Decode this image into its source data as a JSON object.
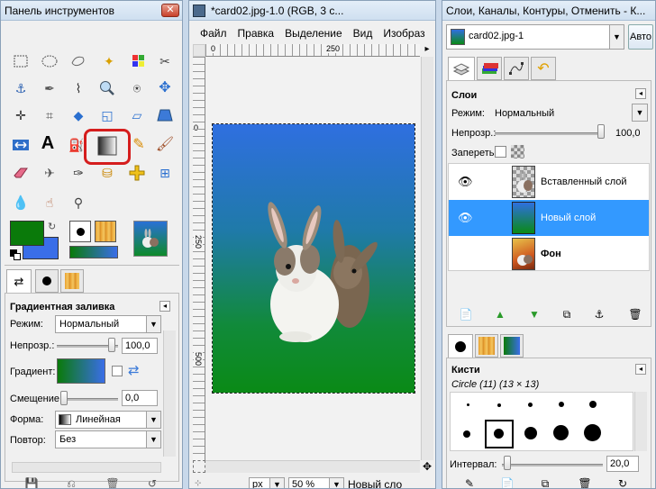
{
  "toolbox": {
    "title": "Панель инструментов",
    "gradient_title": "Градиентная заливка",
    "mode_label": "Режим:",
    "mode_value": "Нормальный",
    "opacity_label": "Непрозр.:",
    "opacity_value": "100,0",
    "gradient_label": "Градиент:",
    "offset_label": "Смещение:",
    "offset_value": "0,0",
    "shape_label": "Форма:",
    "shape_value": "Линейная",
    "repeat_label": "Повтор:",
    "repeat_value": "Без"
  },
  "image_window": {
    "title": "*card02.jpg-1.0 (RGB, 3 с...",
    "menu": [
      "Файл",
      "Правка",
      "Выделение",
      "Вид",
      "Изобраз"
    ],
    "ruler_h": [
      "0",
      "250"
    ],
    "ruler_v": [
      "0",
      "250",
      "500"
    ],
    "unit": "px",
    "zoom": "50 %",
    "status": "Новый сло"
  },
  "layers": {
    "title": "Слои, Каналы, Контуры, Отменить - К...",
    "image_select": "card02.jpg-1",
    "auto_label": "Авто",
    "panel_title": "Слои",
    "mode_label": "Режим:",
    "mode_value": "Нормальный",
    "opacity_label": "Непрозр.:",
    "opacity_value": "100,0",
    "lock_label": "Запереть:",
    "items": [
      {
        "name": "Вставленный слой",
        "bold": false,
        "selected": false,
        "eye": true
      },
      {
        "name": "Новый слой",
        "bold": false,
        "selected": true,
        "eye": true
      },
      {
        "name": "Фон",
        "bold": true,
        "selected": false,
        "eye": false
      }
    ]
  },
  "brushes": {
    "title": "Кисти",
    "current": "Circle (11) (13 × 13)",
    "spacing_label": "Интервал:",
    "spacing_value": "20,0"
  },
  "colors": {
    "fg": "#0a7a0a",
    "bg": "#3a6ee8",
    "accent_select": "#3399ff",
    "highlight_red": "#d51d1d"
  }
}
